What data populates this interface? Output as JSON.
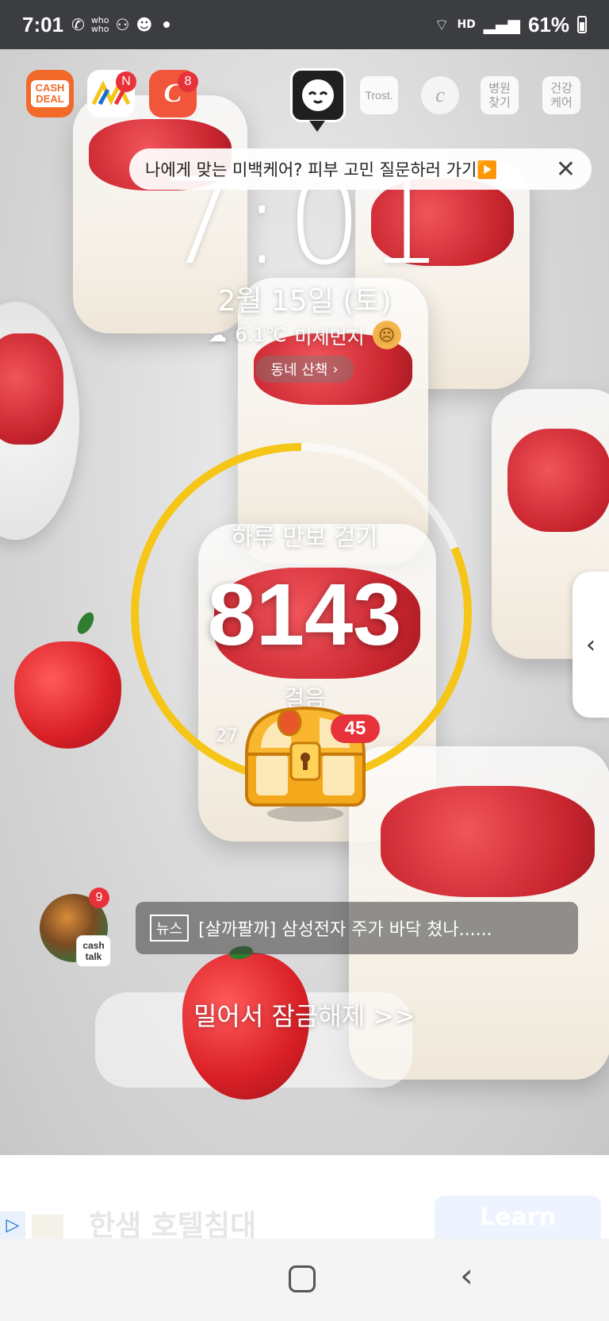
{
  "status_bar": {
    "time": "7:01",
    "network": "HD",
    "battery": "61%",
    "icons": [
      "call-forward-icon",
      "whowho-icon",
      "record-icon",
      "game-icon",
      "wifi-icon",
      "signal-icon",
      "battery-icon"
    ]
  },
  "top_apps": [
    {
      "name": "cash-deal",
      "label": "CASH DEAL",
      "badge": "",
      "color": "#f26a2a"
    },
    {
      "name": "nol",
      "label": "",
      "badge": "N",
      "color": "#ffffff"
    },
    {
      "name": "cashslide",
      "label": "C",
      "badge": "8",
      "color": "#f1563a"
    }
  ],
  "right_tiles": {
    "trost": "Trost.",
    "hospital": "병원\n찾기",
    "health": "건강\n케어"
  },
  "banner": {
    "text": "나에게 맞는 미백케어? 피부 고민 질문하러 가기▶️",
    "close": "✕"
  },
  "clock": "7:01",
  "date": "2월 15일 (토)",
  "weather": {
    "temp": "6.1℃",
    "dust_label": "미세먼지",
    "dust_face": "☹"
  },
  "walk_pill": {
    "label": "동네 산책",
    "arrow": "›"
  },
  "steps": {
    "title": "하루 만보 걷기",
    "count": "8143",
    "unit": "걸음",
    "sub": "27",
    "progress": 0.8143,
    "ring_color": "#f5c518"
  },
  "chest": {
    "badge": "45"
  },
  "side_handle": "‹",
  "news": {
    "avatar_badge": "9",
    "cashtalk": "cash\ntalk",
    "tag": "뉴스",
    "headline": "[살까팔까] 삼성전자 주가 바닥 쳤나......"
  },
  "unlock": "밀어서 잠금해제 >>",
  "ad": {
    "title": "한샘 호텔침대",
    "button": "Learn"
  }
}
